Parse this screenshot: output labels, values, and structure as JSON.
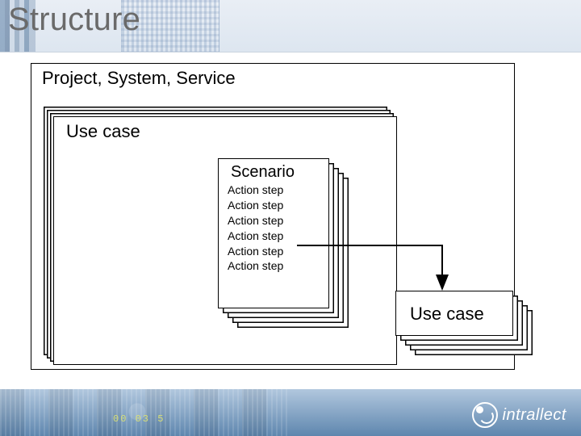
{
  "title": "Structure",
  "outer_label": "Project, System, Service",
  "usecase_label": "Use case",
  "scenario_label": "Scenario",
  "action_steps": [
    "Action step",
    "Action step",
    "Action step",
    "Action step",
    "Action step",
    "Action step"
  ],
  "linked_usecase_label": "Use case",
  "footer_numbers": "00 03 5",
  "brand": "intrallect"
}
